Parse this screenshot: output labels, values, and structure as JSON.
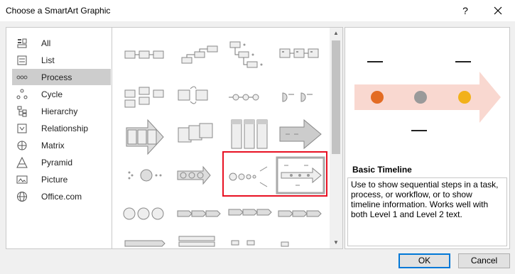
{
  "window": {
    "title": "Choose a SmartArt Graphic",
    "help_label": "?",
    "close_label": "✕"
  },
  "sidebar": {
    "items": [
      {
        "label": "All",
        "icon": "all-icon"
      },
      {
        "label": "List",
        "icon": "list-icon"
      },
      {
        "label": "Process",
        "icon": "process-icon",
        "selected": true
      },
      {
        "label": "Cycle",
        "icon": "cycle-icon"
      },
      {
        "label": "Hierarchy",
        "icon": "hierarchy-icon"
      },
      {
        "label": "Relationship",
        "icon": "relationship-icon"
      },
      {
        "label": "Matrix",
        "icon": "matrix-icon"
      },
      {
        "label": "Pyramid",
        "icon": "pyramid-icon"
      },
      {
        "label": "Picture",
        "icon": "picture-icon"
      },
      {
        "label": "Office.com",
        "icon": "globe-icon"
      }
    ]
  },
  "gallery": {
    "selected_item": "Basic Timeline"
  },
  "preview": {
    "name": "Basic Timeline",
    "description": "Use to show sequential steps in a task, process, or workflow, or to show timeline information. Works well with both Level 1 and Level 2 text.",
    "colors": {
      "arrow": "#f9d8d0",
      "circle1": "#e36c24",
      "circle2": "#9a9a9a",
      "circle3": "#f2b11a"
    }
  },
  "buttons": {
    "ok": "OK",
    "cancel": "Cancel"
  }
}
